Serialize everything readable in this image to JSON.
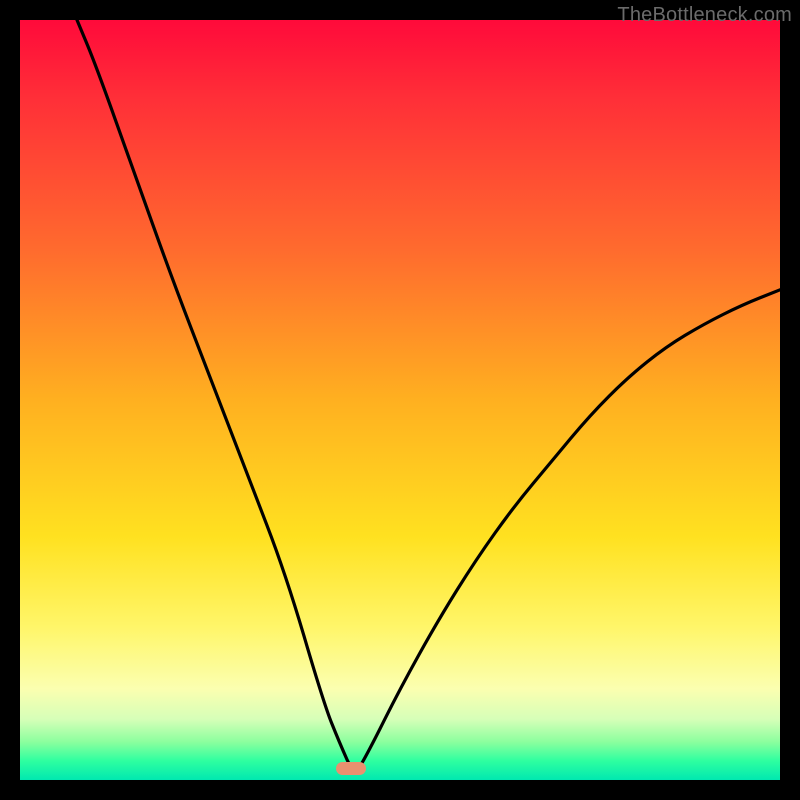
{
  "watermark": "TheBottleneck.com",
  "marker": {
    "cx": 0.435,
    "cy": 0.9855
  },
  "colors": {
    "frame": "#000000",
    "curve": "#000000",
    "marker": "#e9906f",
    "gradient_stops": [
      "#ff0a3a",
      "#ff2e38",
      "#ff6a2e",
      "#ffb020",
      "#ffe120",
      "#fff66a",
      "#fbffb0",
      "#d6ffb8",
      "#8bff9e",
      "#2effa0",
      "#00e8b0"
    ]
  },
  "chart_data": {
    "type": "line",
    "title": "",
    "xlabel": "",
    "ylabel": "",
    "xlim": [
      0,
      1
    ],
    "ylim": [
      0,
      1
    ],
    "note": "Normalized coordinates. (0,0) bottom-left, (1,1) top-right. Curve is a V-shape with minimum near x≈0.44, y≈0.",
    "series": [
      {
        "name": "curve",
        "x": [
          0.075,
          0.1,
          0.15,
          0.2,
          0.25,
          0.3,
          0.35,
          0.4,
          0.42,
          0.44,
          0.46,
          0.5,
          0.55,
          0.6,
          0.65,
          0.7,
          0.75,
          0.8,
          0.85,
          0.9,
          0.95,
          1.0
        ],
        "y": [
          1.0,
          0.94,
          0.8,
          0.66,
          0.53,
          0.4,
          0.27,
          0.1,
          0.05,
          0.005,
          0.04,
          0.12,
          0.21,
          0.29,
          0.36,
          0.42,
          0.48,
          0.53,
          0.57,
          0.6,
          0.625,
          0.645
        ]
      }
    ],
    "marker": {
      "x": 0.435,
      "y": 0.0145
    }
  }
}
